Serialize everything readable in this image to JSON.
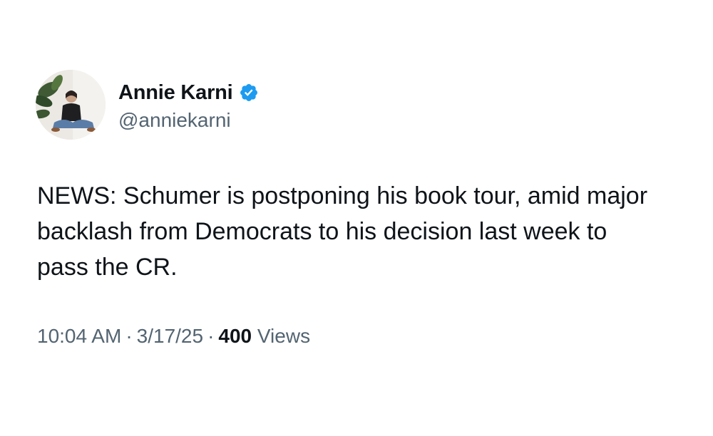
{
  "author": {
    "name": "Annie Karni",
    "handle": "@anniekarni",
    "verified": true,
    "verified_color": "#1d9bf0"
  },
  "tweet": {
    "text": "NEWS: Schumer is postponing his book tour, amid major backlash from Democrats to his decision last week to pass the CR."
  },
  "meta": {
    "time": "10:04 AM",
    "separator": "·",
    "date": "3/17/25",
    "views_count": "400",
    "views_label": "Views"
  },
  "colors": {
    "text_primary": "#0f1419",
    "text_secondary": "#536471"
  }
}
